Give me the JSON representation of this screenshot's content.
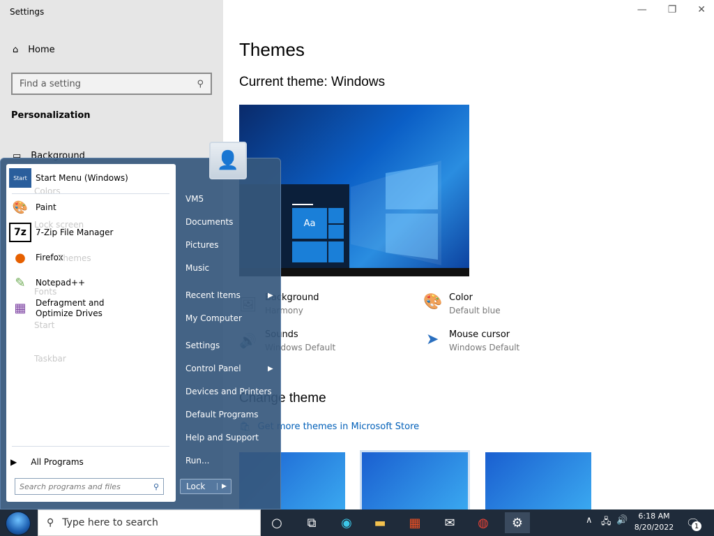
{
  "settings": {
    "title": "Settings",
    "home": "Home",
    "search_placeholder": "Find a setting",
    "section": "Personalization",
    "nav": [
      "Background",
      "Colors",
      "Lock screen",
      "Themes",
      "Fonts",
      "Start",
      "Taskbar"
    ]
  },
  "themes": {
    "heading": "Themes",
    "current": "Current theme: Windows",
    "attrs": [
      {
        "title": "Background",
        "value": "Harmony"
      },
      {
        "title": "Color",
        "value": "Default blue"
      },
      {
        "title": "Sounds",
        "value": "Windows Default"
      },
      {
        "title": "Mouse cursor",
        "value": "Windows Default"
      }
    ],
    "change_heading": "Change theme",
    "store_link": "Get more themes in Microsoft Store",
    "preview_text": "Aa"
  },
  "start_menu": {
    "programs": [
      {
        "label": "Start Menu (Windows)",
        "icon": "start-menu-icon"
      },
      {
        "label": "Paint",
        "icon": "paint-icon"
      },
      {
        "label": "7-Zip File Manager",
        "icon": "7zip-icon"
      },
      {
        "label": "Firefox",
        "icon": "firefox-icon"
      },
      {
        "label": "Notepad++",
        "icon": "notepadpp-icon"
      },
      {
        "label": "Defragment and Optimize Drives",
        "icon": "defrag-icon"
      }
    ],
    "all_programs": "All Programs",
    "search_placeholder": "Search programs and files",
    "right_items": [
      "VM5",
      "Documents",
      "Pictures",
      "Music",
      "Recent Items",
      "My Computer",
      "Settings",
      "Control Panel",
      "Devices and Printers",
      "Default Programs",
      "Help and Support",
      "Run..."
    ],
    "lock_label": "Lock"
  },
  "taskbar": {
    "search_placeholder": "Type here to search",
    "time": "6:18 AM",
    "date": "8/20/2022",
    "notification_count": "1"
  }
}
